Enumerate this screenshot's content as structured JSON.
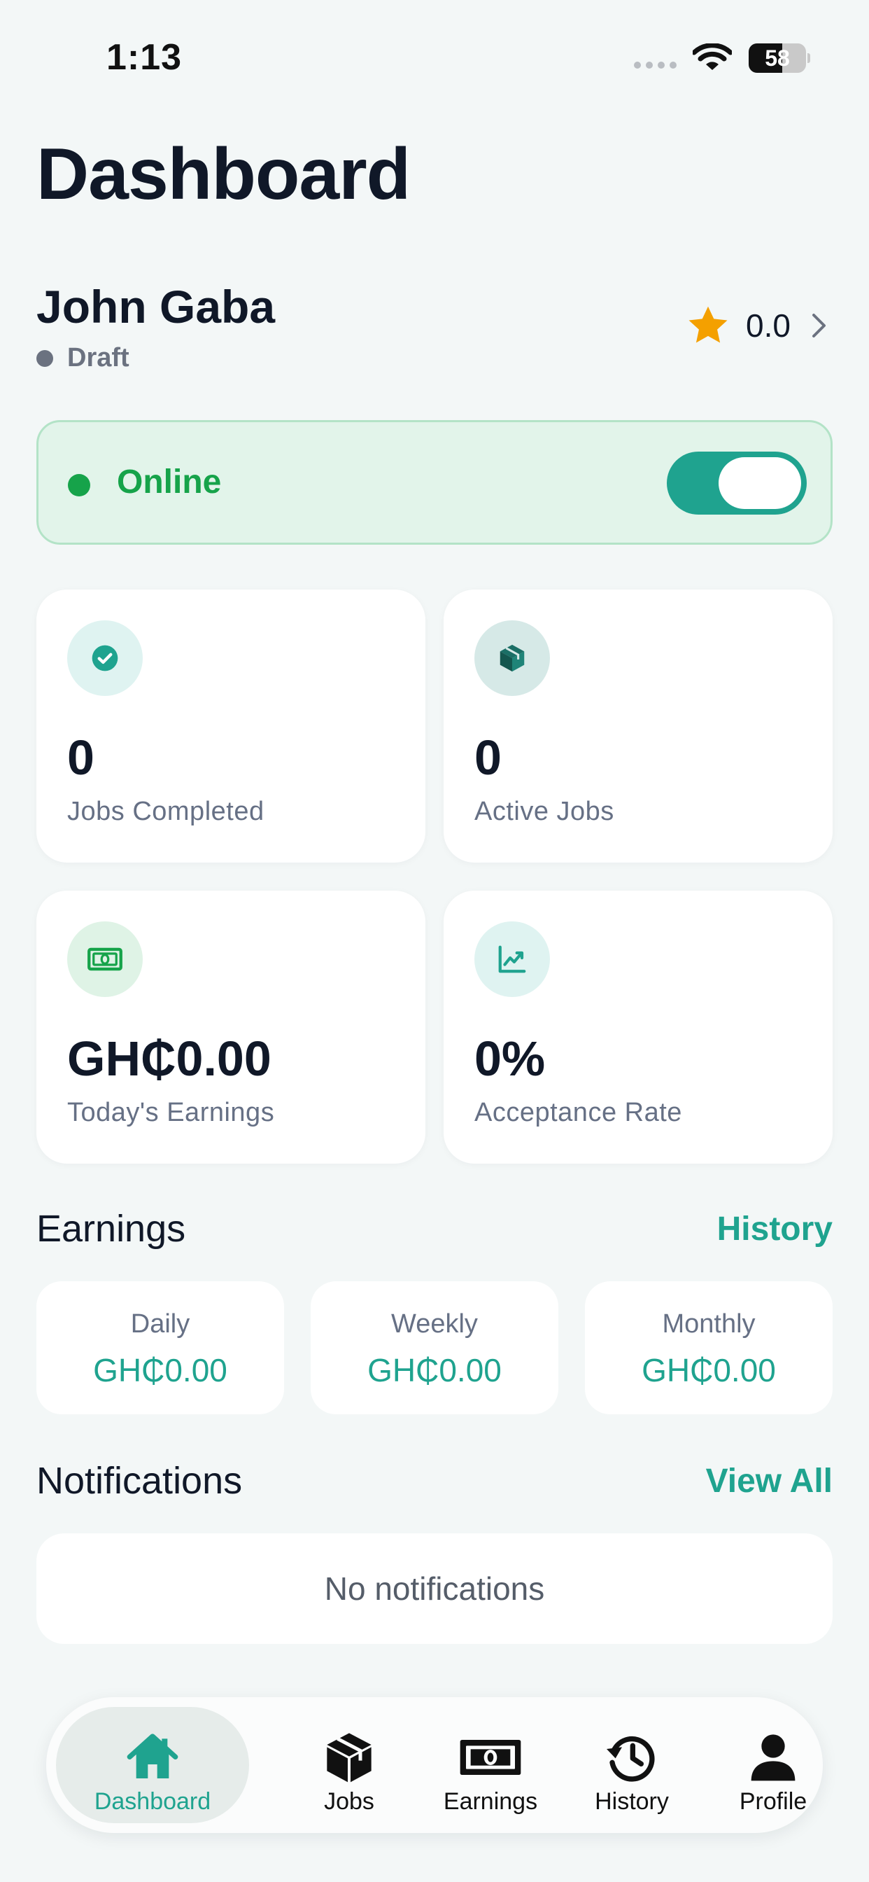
{
  "status_bar": {
    "time": "1:13",
    "battery": "58",
    "battery_level": 0.58
  },
  "header": {
    "title": "Dashboard"
  },
  "driver": {
    "name": "John Gaba",
    "status": "Draft",
    "rating": "0.0"
  },
  "availability": {
    "label": "Online",
    "enabled": true
  },
  "stats": [
    {
      "value": "0",
      "label": "Jobs Completed",
      "icon": "check-circle-icon"
    },
    {
      "value": "0",
      "label": "Active Jobs",
      "icon": "package-icon"
    },
    {
      "value": "GH₵0.00",
      "label": "Today's Earnings",
      "icon": "cash-icon"
    },
    {
      "value": "0%",
      "label": "Acceptance Rate",
      "icon": "trending-up-icon"
    }
  ],
  "earnings": {
    "title": "Earnings",
    "link": "History",
    "periods": [
      {
        "label": "Daily",
        "amount": "GH₵0.00"
      },
      {
        "label": "Weekly",
        "amount": "GH₵0.00"
      },
      {
        "label": "Monthly",
        "amount": "GH₵0.00"
      }
    ]
  },
  "notifications": {
    "title": "Notifications",
    "link": "View All",
    "empty_text": "No notifications"
  },
  "tabs": [
    {
      "label": "Dashboard",
      "icon": "home-icon",
      "active": true
    },
    {
      "label": "Jobs",
      "icon": "package-icon",
      "active": false
    },
    {
      "label": "Earnings",
      "icon": "cash-icon",
      "active": false
    },
    {
      "label": "History",
      "icon": "history-icon",
      "active": false
    },
    {
      "label": "Profile",
      "icon": "person-icon",
      "active": false
    }
  ],
  "colors": {
    "accent": "#1fa38f",
    "online_green": "#16a34a",
    "star": "#f4a000",
    "background": "#f3f7f7"
  }
}
